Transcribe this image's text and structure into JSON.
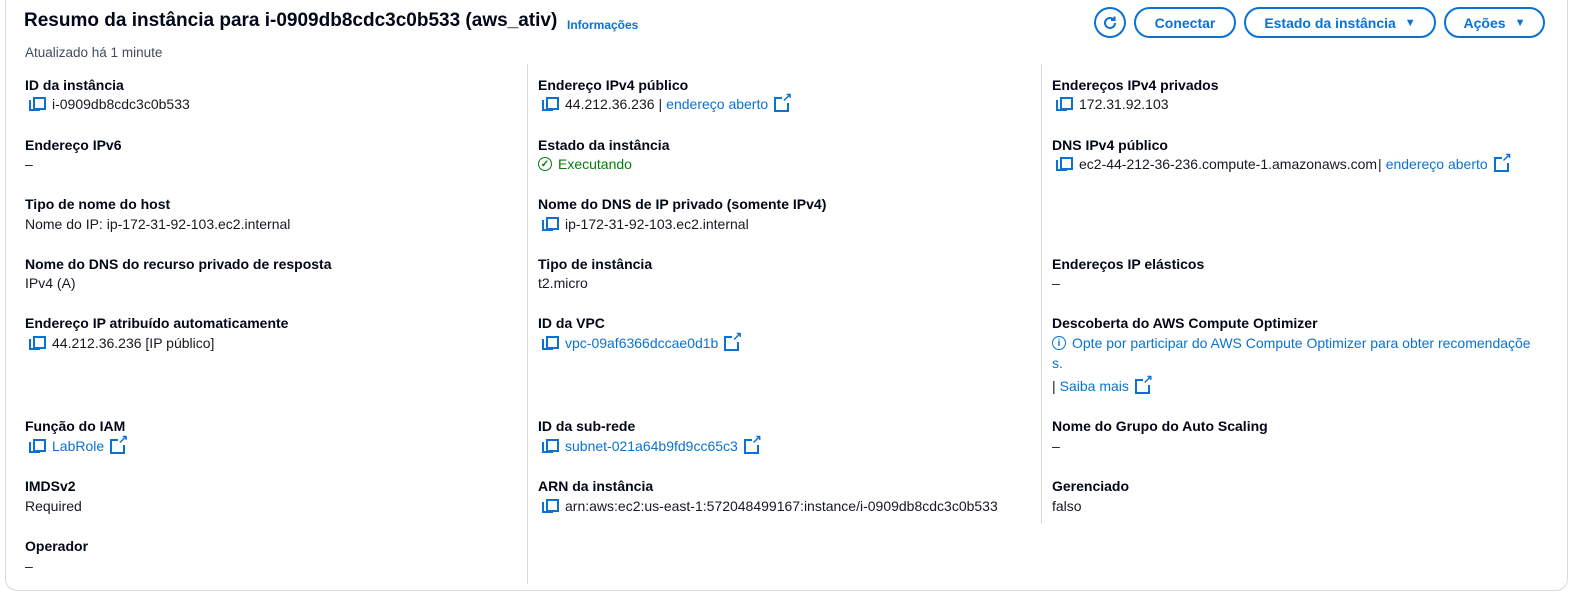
{
  "header": {
    "title": "Resumo da instância para i-0909db8cdc3c0b533 (aws_ativ)",
    "info_link": "Informações",
    "updated": "Atualizado há 1 minute",
    "buttons": {
      "refresh_icon": "refresh-icon",
      "connect": "Conectar",
      "instance_state": "Estado da instância",
      "actions": "Ações"
    }
  },
  "col1": {
    "instance_id_label": "ID da instância",
    "instance_id": "i-0909db8cdc3c0b533",
    "ipv6_label": "Endereço IPv6",
    "ipv6": "–",
    "hostname_type_label": "Tipo de nome do host",
    "hostname_type": "Nome do IP: ip-172-31-92-103.ec2.internal",
    "private_dns_resource_label": "Nome do DNS do recurso privado de resposta",
    "private_dns_resource": "IPv4 (A)",
    "auto_ip_label": "Endereço IP atribuído automaticamente",
    "auto_ip": "44.212.36.236 [IP público]",
    "iam_role_label": "Função do IAM",
    "iam_role": "LabRole",
    "imdsv2_label": "IMDSv2",
    "imdsv2": "Required",
    "operator_label": "Operador",
    "operator": "–"
  },
  "col2": {
    "public_ipv4_label": "Endereço IPv4 público",
    "public_ipv4": "44.212.36.236",
    "open_address": "endereço aberto",
    "state_label": "Estado da instância",
    "state": "Executando",
    "private_dns_label": "Nome do DNS de IP privado (somente IPv4)",
    "private_dns": "ip-172-31-92-103.ec2.internal",
    "instance_type_label": "Tipo de instância",
    "instance_type": "t2.micro",
    "vpc_label": "ID da VPC",
    "vpc": "vpc-09af6366dccae0d1b",
    "subnet_label": "ID da sub-rede",
    "subnet": "subnet-021a64b9fd9cc65c3",
    "arn_label": "ARN da instância",
    "arn": "arn:aws:ec2:us-east-1:572048499167:instance/i-0909db8cdc3c0b533"
  },
  "col3": {
    "private_ipv4_label": "Endereços IPv4 privados",
    "private_ipv4": "172.31.92.103",
    "public_dns_label": "DNS IPv4 público",
    "public_dns": "ec2-44-212-36-236.compute-1.amazonaws.com",
    "open_address": "endereço aberto",
    "elastic_ip_label": "Endereços IP elásticos",
    "elastic_ip": "–",
    "optimizer_label": "Descoberta do AWS Compute Optimizer",
    "optimizer_line1": "Opte por participar do AWS Compute Optimizer para obter recomendaçõe",
    "optimizer_line2": "s.",
    "learn_more": "Saiba mais",
    "asg_label": "Nome do Grupo do Auto Scaling",
    "asg": "–",
    "managed_label": "Gerenciado",
    "managed": "falso"
  }
}
